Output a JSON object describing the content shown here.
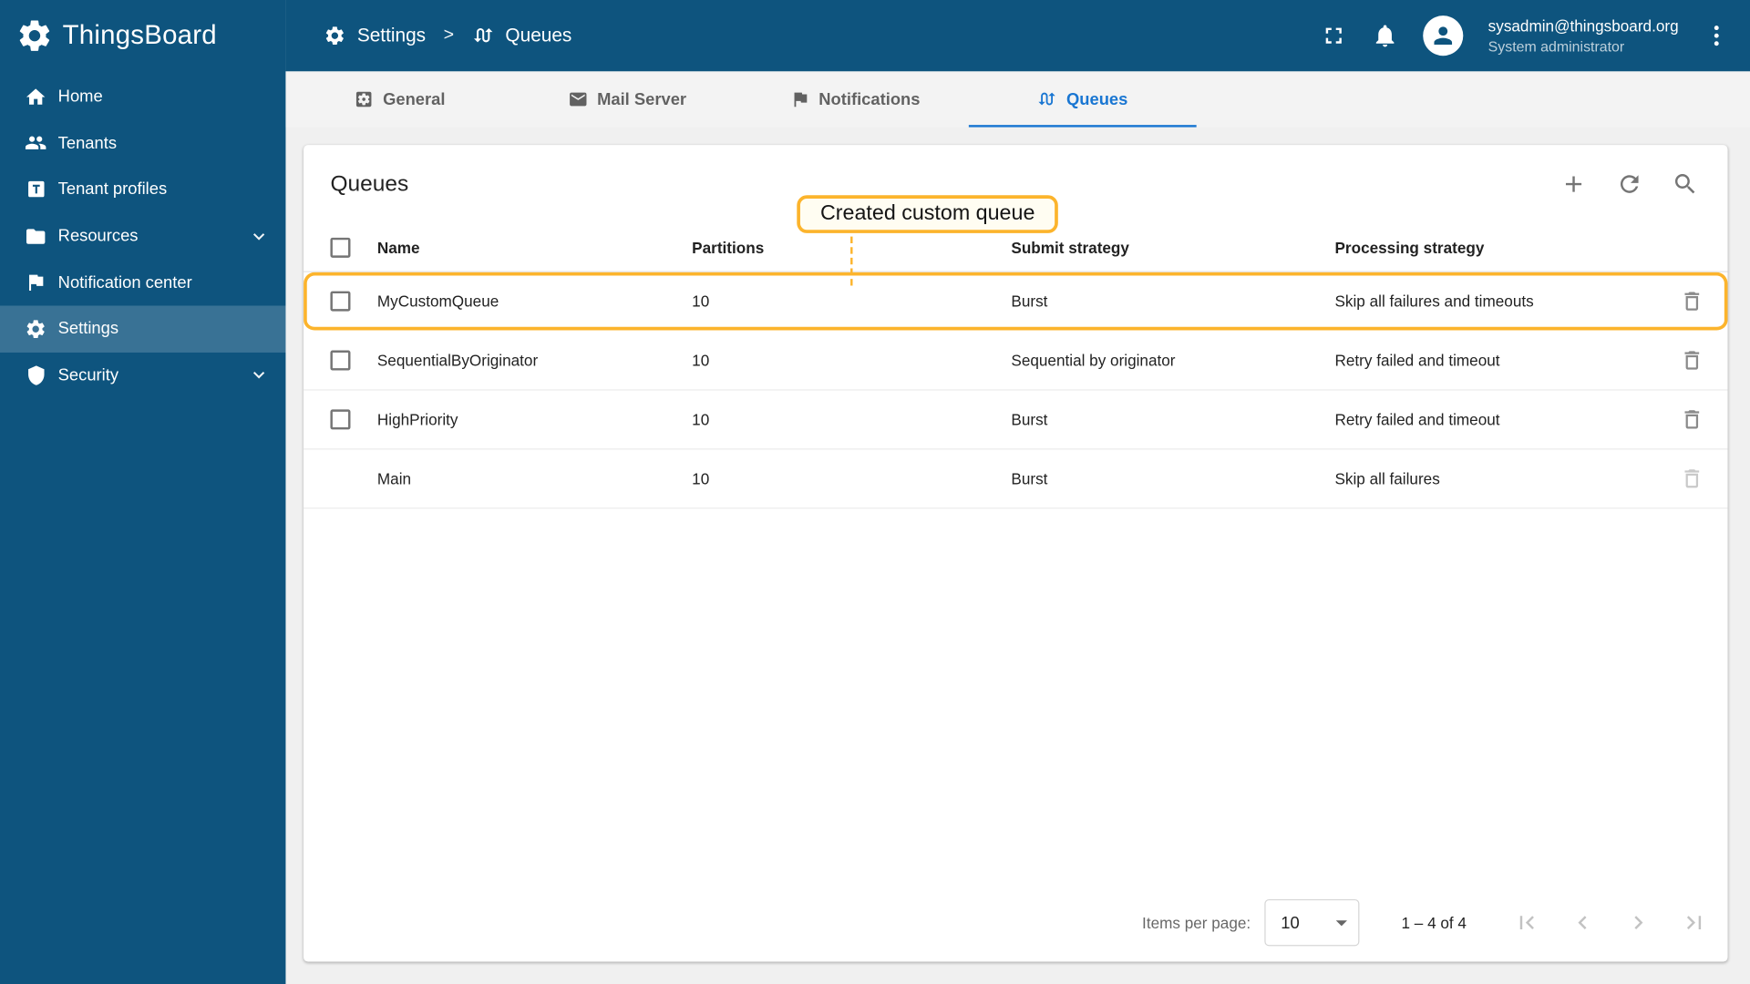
{
  "app": {
    "name": "ThingsBoard"
  },
  "header": {
    "breadcrumb": {
      "settings": "Settings",
      "separator": ">",
      "queues": "Queues"
    },
    "user": {
      "email": "sysadmin@thingsboard.org",
      "role": "System administrator"
    }
  },
  "sidebar": {
    "items": [
      {
        "label": "Home",
        "icon": "home-icon"
      },
      {
        "label": "Tenants",
        "icon": "tenants-icon"
      },
      {
        "label": "Tenant profiles",
        "icon": "tenant-profiles-icon"
      },
      {
        "label": "Resources",
        "icon": "folder-icon",
        "expandable": true
      },
      {
        "label": "Notification center",
        "icon": "flag-icon"
      },
      {
        "label": "Settings",
        "icon": "gear-icon",
        "active": true
      },
      {
        "label": "Security",
        "icon": "shield-icon",
        "expandable": true
      }
    ]
  },
  "tabs": [
    {
      "label": "General",
      "icon": "general-settings-icon"
    },
    {
      "label": "Mail Server",
      "icon": "mail-icon"
    },
    {
      "label": "Notifications",
      "icon": "flag-icon"
    },
    {
      "label": "Queues",
      "icon": "queues-icon",
      "active": true
    }
  ],
  "main": {
    "title": "Queues",
    "callout": "Created custom queue",
    "table": {
      "columns": [
        "Name",
        "Partitions",
        "Submit strategy",
        "Processing strategy"
      ],
      "rows": [
        {
          "name": "MyCustomQueue",
          "partitions": "10",
          "submit_strategy": "Burst",
          "processing_strategy": "Skip all failures and timeouts",
          "highlighted": true
        },
        {
          "name": "SequentialByOriginator",
          "partitions": "10",
          "submit_strategy": "Sequential by originator",
          "processing_strategy": "Retry failed and timeout"
        },
        {
          "name": "HighPriority",
          "partitions": "10",
          "submit_strategy": "Burst",
          "processing_strategy": "Retry failed and timeout"
        },
        {
          "name": "Main",
          "partitions": "10",
          "submit_strategy": "Burst",
          "processing_strategy": "Skip all failures",
          "system": true
        }
      ]
    },
    "pagination": {
      "items_per_page_label": "Items per page:",
      "page_size": "10",
      "range": "1 – 4 of 4"
    }
  },
  "colors": {
    "primary": "#0e547e",
    "tab_active": "#1976d2",
    "highlight": "#fcb42c"
  }
}
